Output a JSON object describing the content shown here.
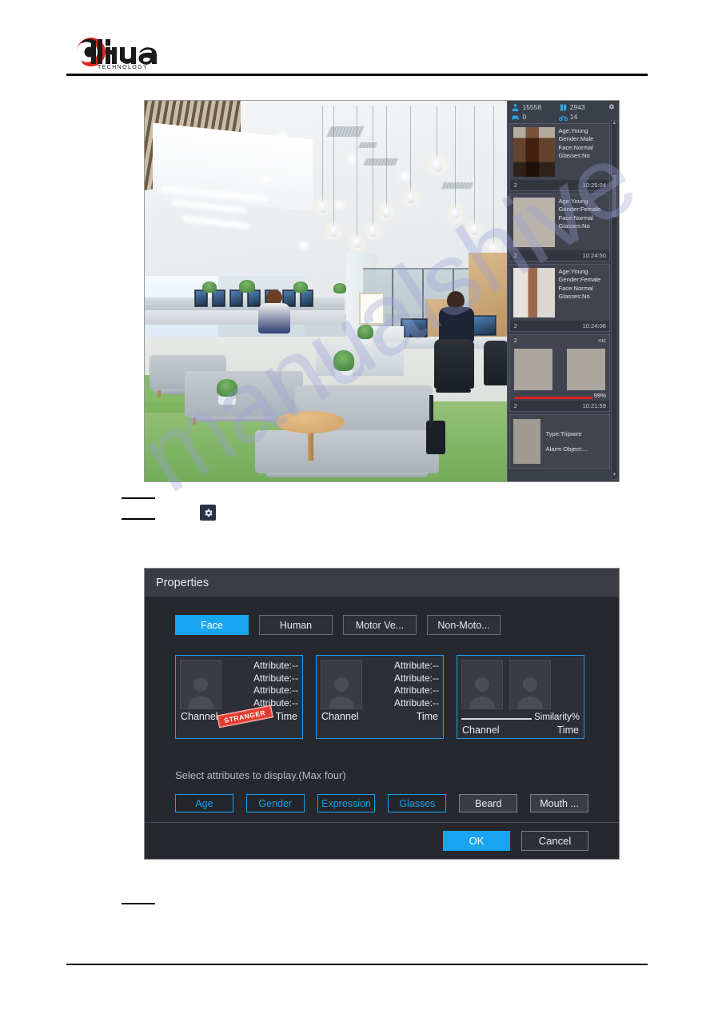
{
  "brand": {
    "name": "alhua",
    "tagline": "TECHNOLOGY"
  },
  "watermark": "manualshive",
  "live_view": {
    "stats": [
      {
        "icon": "person-icon",
        "value": "15558"
      },
      {
        "icon": "human-body-icon",
        "value": "2943"
      },
      {
        "icon": "car-icon",
        "value": "0"
      },
      {
        "icon": "motorbike-icon",
        "value": "14"
      }
    ],
    "settings_icon": "gear-icon",
    "face_cards": [
      {
        "attributes": [
          "Age:Young",
          "Gender:Male",
          "Face:Normal",
          "Glasses:No"
        ],
        "channel": "2",
        "time": "10:25:04"
      },
      {
        "attributes": [
          "Age:Young",
          "Gender:Female",
          "Face:Normal",
          "Glasses:No"
        ],
        "channel": "2",
        "time": "10:24:50"
      },
      {
        "attributes": [
          "Age:Young",
          "Gender:Female",
          "Face:Normal",
          "Glasses:No"
        ],
        "channel": "2",
        "time": "10:24:06"
      }
    ],
    "compare_card": {
      "channel": "2",
      "name": "nic",
      "similarity": "99%",
      "footer_channel": "2",
      "time": "10:21:59"
    },
    "alarm_card": {
      "type_label": "Type:Tripwire",
      "object_label": "Alarm Object:..."
    },
    "scrollbar": {
      "up": "▲",
      "down": "▼"
    }
  },
  "inline_icon": {
    "name": "gear-icon"
  },
  "dialog": {
    "title": "Properties",
    "tabs": [
      {
        "label": "Face",
        "active": true
      },
      {
        "label": "Human",
        "active": false
      },
      {
        "label": "Motor Ve...",
        "active": false
      },
      {
        "label": "Non-Moto...",
        "active": false
      }
    ],
    "preview_cards": [
      {
        "type": "single",
        "attributes": [
          "Attribute:--",
          "Attribute:--",
          "Attribute:--",
          "Attribute:--"
        ],
        "channel": "Channel",
        "time": "Time",
        "stamp": "STRANGER"
      },
      {
        "type": "single",
        "attributes": [
          "Attribute:--",
          "Attribute:--",
          "Attribute:--",
          "Attribute:--"
        ],
        "channel": "Channel",
        "time": "Time",
        "stamp": ""
      },
      {
        "type": "compare",
        "similarity_label": "Similarity%",
        "channel": "Channel",
        "time": "Time"
      }
    ],
    "select_hint": "Select attributes to display.(Max four)",
    "attribute_buttons": [
      {
        "label": "Age",
        "selected": true
      },
      {
        "label": "Gender",
        "selected": true
      },
      {
        "label": "Expression",
        "selected": true
      },
      {
        "label": "Glasses",
        "selected": true
      },
      {
        "label": "Beard",
        "selected": false
      },
      {
        "label": "Mouth ...",
        "selected": false
      }
    ],
    "ok_label": "OK",
    "cancel_label": "Cancel"
  },
  "colors": {
    "accent_blue": "#19a4f0",
    "brand_red": "#e2231a",
    "similarity_bar": "#e02020",
    "stranger_red": "#e23b2e"
  }
}
